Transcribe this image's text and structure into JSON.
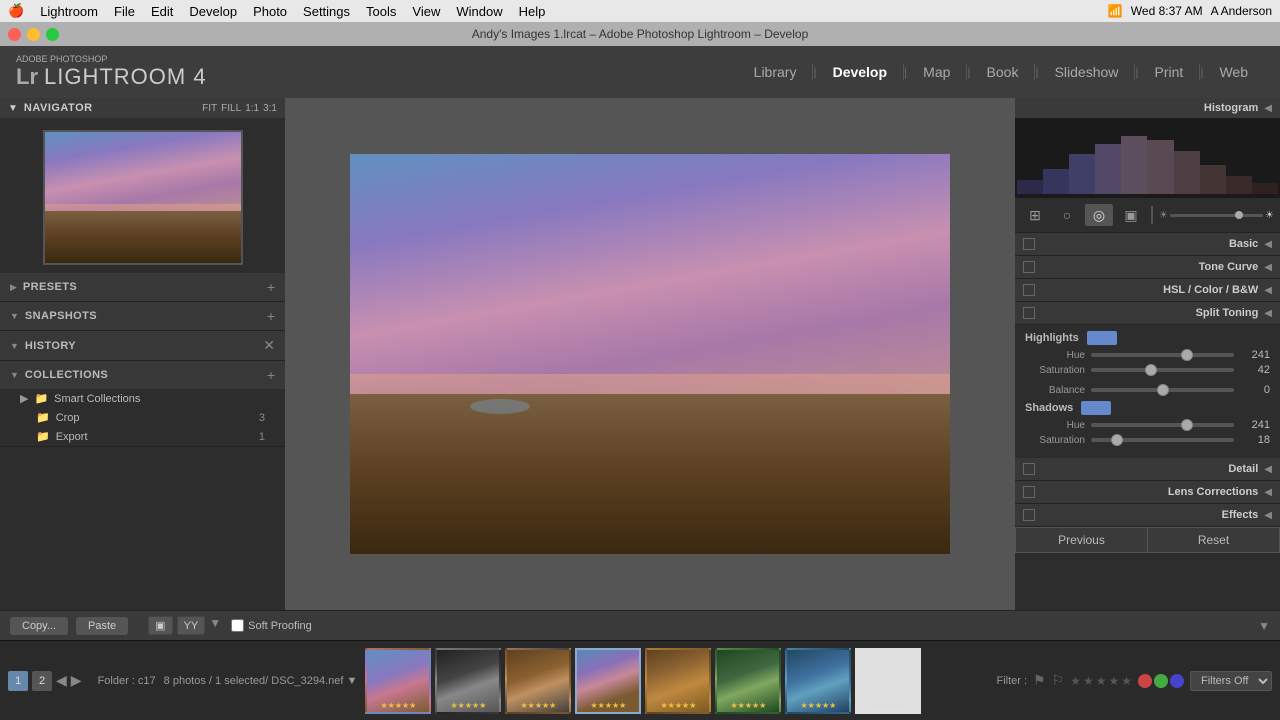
{
  "menubar": {
    "apple": "🍎",
    "app": "Lightroom",
    "menus": [
      "File",
      "Edit",
      "Develop",
      "Photo",
      "Settings",
      "Tools",
      "View",
      "Window",
      "Help"
    ],
    "time": "Wed 8:37 AM",
    "user": "A Anderson"
  },
  "titlebar": {
    "title": "Andy's Images 1.lrcat – Adobe Photoshop Lightroom – Develop"
  },
  "topnav": {
    "brand_line1": "ADOBE PHOTOSHOP",
    "brand_line2": "LIGHTROOM 4",
    "tabs": [
      "Library",
      "Develop",
      "Map",
      "Book",
      "Slideshow",
      "Print",
      "Web"
    ],
    "active_tab": "Develop"
  },
  "left_panel": {
    "navigator": {
      "title": "Navigator",
      "fit_label": "FIT",
      "fill_label": "FILL",
      "ratio1": "1:1",
      "ratio2": "3:1"
    },
    "presets": {
      "label": "Presets"
    },
    "snapshots": {
      "label": "Snapshots"
    },
    "history": {
      "label": "History"
    },
    "collections": {
      "label": "Collections",
      "items": [
        {
          "name": "Smart Collections",
          "icon": "▶",
          "sub": [
            {
              "name": "Crop",
              "count": "3"
            },
            {
              "name": "Export",
              "count": "1"
            }
          ]
        }
      ]
    }
  },
  "right_panel": {
    "histogram_label": "Histogram",
    "sections": [
      {
        "id": "basic",
        "label": "Basic"
      },
      {
        "id": "tone-curve",
        "label": "Tone Curve"
      },
      {
        "id": "hsl",
        "label": "HSL / Color / B&W"
      },
      {
        "id": "split-toning",
        "label": "Split Toning"
      },
      {
        "id": "detail",
        "label": "Detail"
      },
      {
        "id": "lens-corrections",
        "label": "Lens Corrections"
      },
      {
        "id": "effects",
        "label": "Effects"
      }
    ],
    "split_toning": {
      "highlights_label": "Highlights",
      "hue_label": "Hue",
      "saturation_label": "Saturation",
      "balance_label": "Balance",
      "shadows_label": "Shadows",
      "highlights_hue": 241,
      "highlights_sat": 42,
      "balance": 0,
      "shadows_hue": 241,
      "shadows_sat": 18,
      "highlights_hue_pct": 67,
      "highlights_sat_pct": 42,
      "balance_pct": 50,
      "shadows_hue_pct": 67,
      "shadows_sat_pct": 18
    },
    "prev_button": "Previous",
    "reset_button": "Reset"
  },
  "bottom_toolbar": {
    "copy_label": "Copy...",
    "paste_label": "Paste",
    "soft_proofing_label": "Soft Proofing"
  },
  "filmstrip": {
    "page1": "1",
    "page2": "2",
    "folder": "Folder : c17",
    "photo_count": "8 photos / 1 selected",
    "filename": "DSC_3294.nef",
    "filter_label": "Filter :",
    "filters_off": "Filters Off",
    "thumbs": [
      {
        "id": 1,
        "stars": "★★★★★",
        "class": "thumb-1"
      },
      {
        "id": 2,
        "stars": "★★★★★",
        "class": "thumb-2"
      },
      {
        "id": 3,
        "stars": "★★★★★",
        "class": "thumb-3"
      },
      {
        "id": 4,
        "stars": "★★★★★",
        "class": "thumb-4",
        "selected": true
      },
      {
        "id": 5,
        "stars": "★★★★★",
        "class": "thumb-5"
      },
      {
        "id": 6,
        "stars": "★★★★★",
        "class": "thumb-6"
      },
      {
        "id": 7,
        "stars": "★★★★★",
        "class": "thumb-7"
      },
      {
        "id": 8,
        "stars": "★★★★★",
        "class": "thumb-8"
      }
    ]
  },
  "colors": {
    "accent_blue": "#6688cc",
    "selected_border": "#8aabcc",
    "panel_bg": "#2d2d2d",
    "header_bg": "#383838"
  }
}
